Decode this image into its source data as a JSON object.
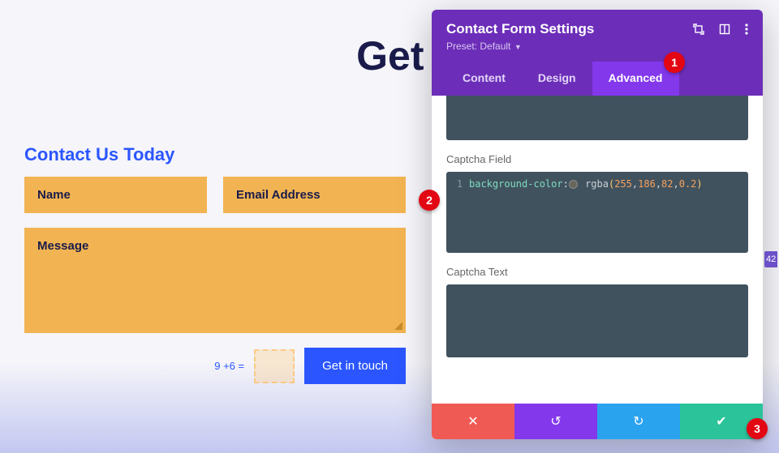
{
  "hero": {
    "title": "Get in"
  },
  "section": {
    "title": "Contact Us Today"
  },
  "form": {
    "name_placeholder": "Name",
    "email_placeholder": "Email Address",
    "message_placeholder": "Message",
    "captcha_question": "9 +6 =",
    "submit_label": "Get in touch"
  },
  "panel": {
    "title": "Contact Form Settings",
    "preset_label": "Preset: Default",
    "tabs": {
      "content": "Content",
      "design": "Design",
      "advanced": "Advanced",
      "active": "advanced"
    },
    "sections": {
      "captcha_field": "Captcha Field",
      "captcha_text": "Captcha Text"
    },
    "code": {
      "line_no": "1",
      "property": "background-color",
      "func": "rgba",
      "args": [
        "255",
        "186",
        "82",
        "0.2"
      ]
    }
  },
  "badges": {
    "b1": "1",
    "b2": "2",
    "b3": "3"
  },
  "float": {
    "label": "42"
  }
}
